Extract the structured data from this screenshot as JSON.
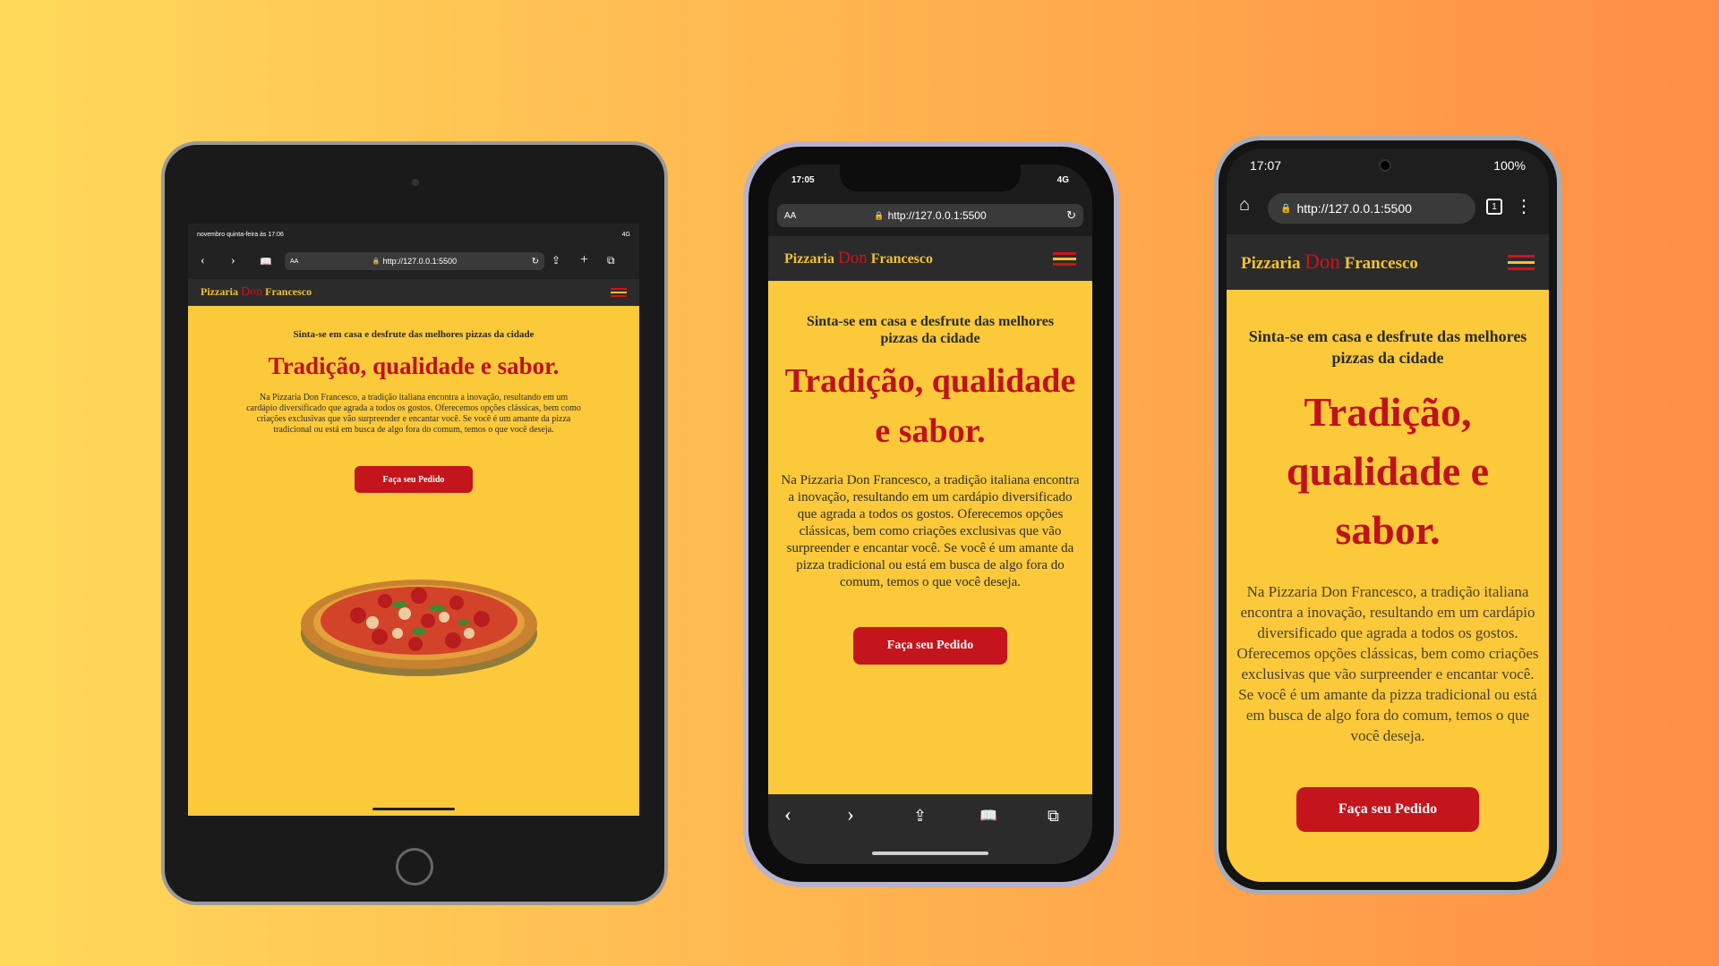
{
  "site": {
    "logo_word1": "Pizzaria",
    "logo_word2": "Don",
    "logo_word3": "Francesco",
    "subtitle": "Sinta-se em casa e desfrute das melhores pizzas da cidade",
    "headline": "Tradição, qualidade e sabor.",
    "paragraph": "Na Pizzaria Don Francesco, a tradição italiana encontra a inovação, resultando em um cardápio diversificado que agrada a todos os gostos. Oferecemos opções clássicas, bem como criações exclusivas que vão surpreender e encantar você. Se você é um amante da pizza tradicional ou está em busca de algo fora do comum, temos o que você deseja.",
    "cta_label": "Faça seu Pedido"
  },
  "tablet": {
    "status_left": "novembro quinta-feira às 17:06",
    "status_right": "4G",
    "url_aa": "AA",
    "url": "http://127.0.0.1:5500"
  },
  "iphone": {
    "time": "17:05",
    "network": "4G",
    "url_aa": "AA",
    "url": "http://127.0.0.1:5500"
  },
  "android": {
    "time": "17:07",
    "battery": "100%",
    "url": "http://127.0.0.1:5500",
    "tabs_count": "1"
  },
  "colors": {
    "brand_red": "#c4141c",
    "brand_yellow": "#fbc93a",
    "nav_dark": "#2b2b2b"
  }
}
